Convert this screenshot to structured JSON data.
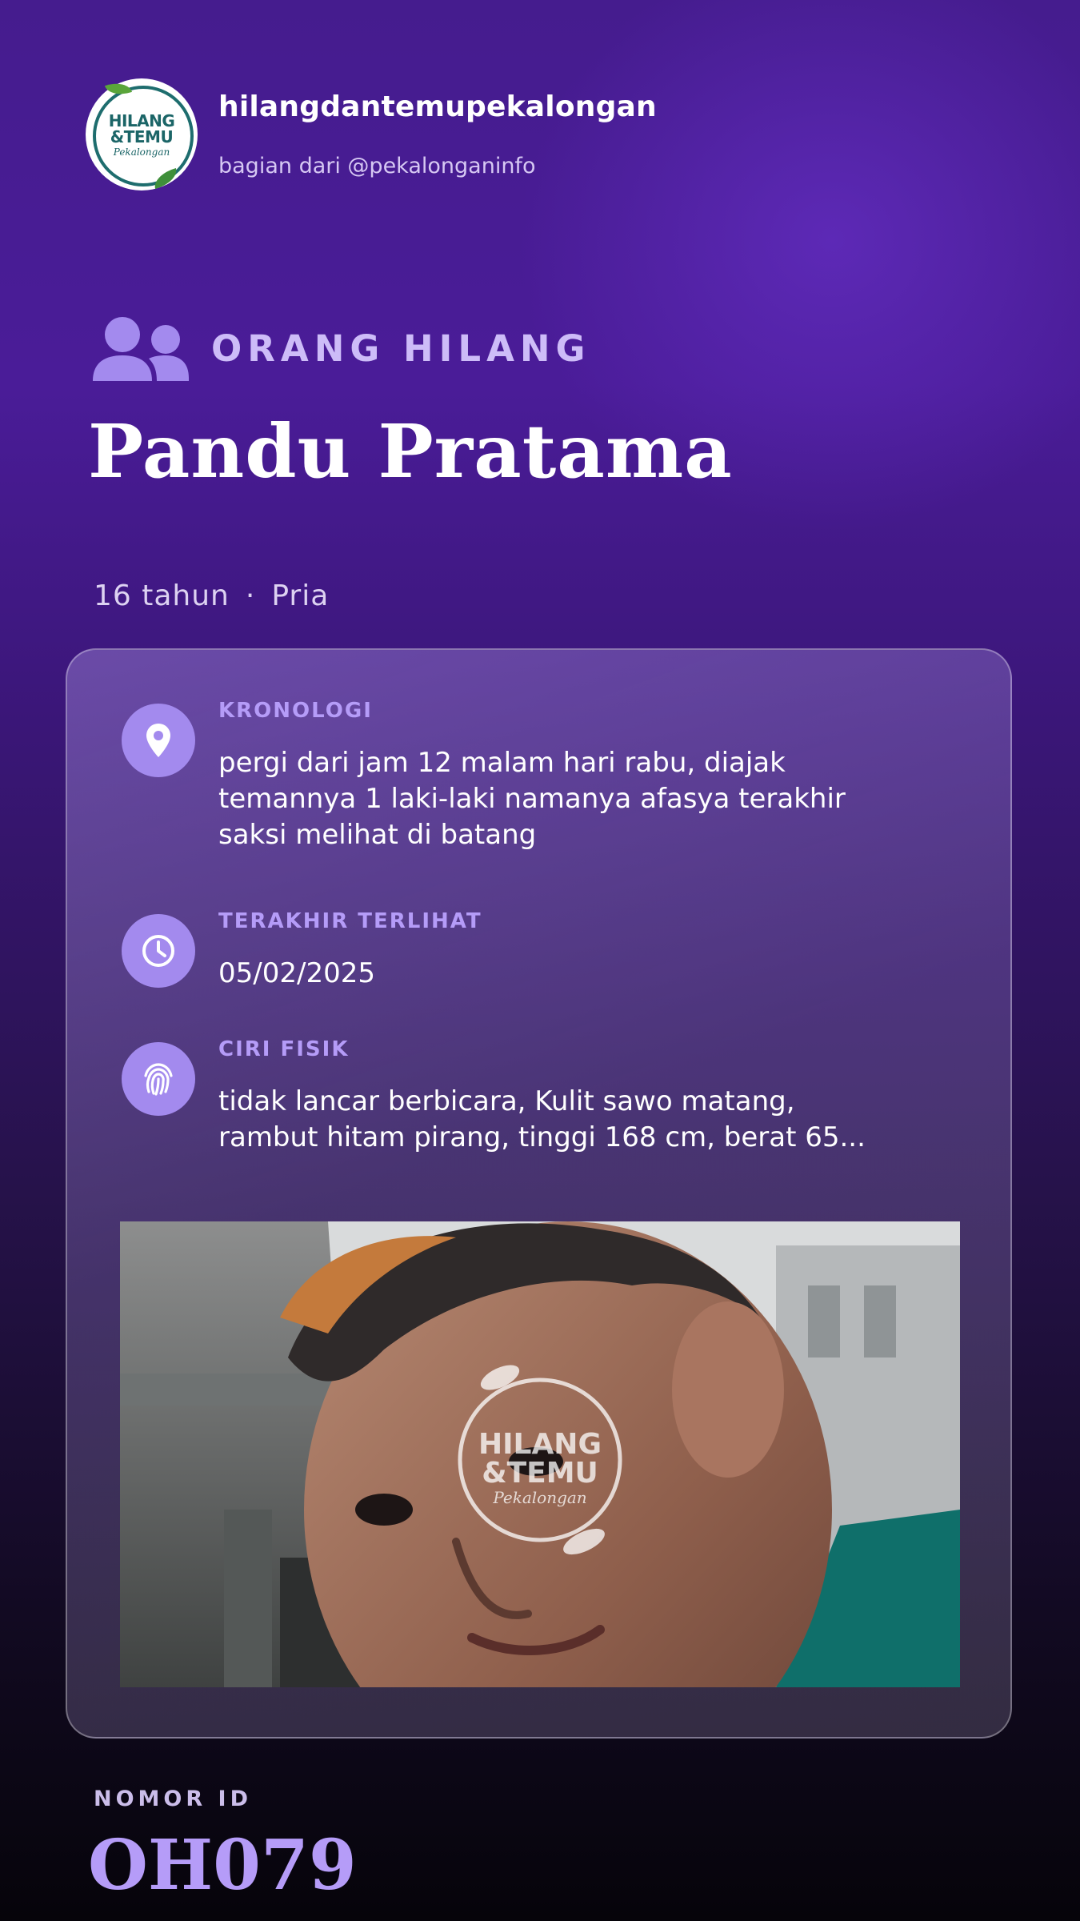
{
  "account": {
    "handle": "hilangdantemupekalongan",
    "subtitle": "bagian dari @pekalonganinfo",
    "logo_text": [
      "HILANG",
      "&TEMU",
      "Pekalongan"
    ]
  },
  "category": {
    "label": "ORANG HILANG",
    "icon": "people-icon"
  },
  "person": {
    "name": "Pandu Pratama",
    "age": "16 tahun",
    "separator": "·",
    "gender": "Pria"
  },
  "details": [
    {
      "icon": "location-pin-icon",
      "title": "KRONOLOGI",
      "text": "pergi dari jam 12 malam hari rabu, diajak temannya 1 laki-laki namanya afasya terakhir saksi melihat di batang"
    },
    {
      "icon": "clock-icon",
      "title": "TERAKHIR TERLIHAT",
      "text": "05/02/2025"
    },
    {
      "icon": "fingerprint-icon",
      "title": "CIRI FISIK",
      "text": "tidak lancar berbicara, Kulit sawo matang, rambut hitam pirang, tinggi 168 cm, berat 65..."
    }
  ],
  "photo": {
    "watermark": [
      "HILANG",
      "&TEMU",
      "Pekalongan"
    ]
  },
  "id": {
    "label": "NOMOR ID",
    "value": "OH079"
  },
  "colors": {
    "accent": "#a38aee",
    "accent_text": "#b59cf8",
    "bg_top": "#4a1c98",
    "bg_bottom": "#06040a"
  }
}
